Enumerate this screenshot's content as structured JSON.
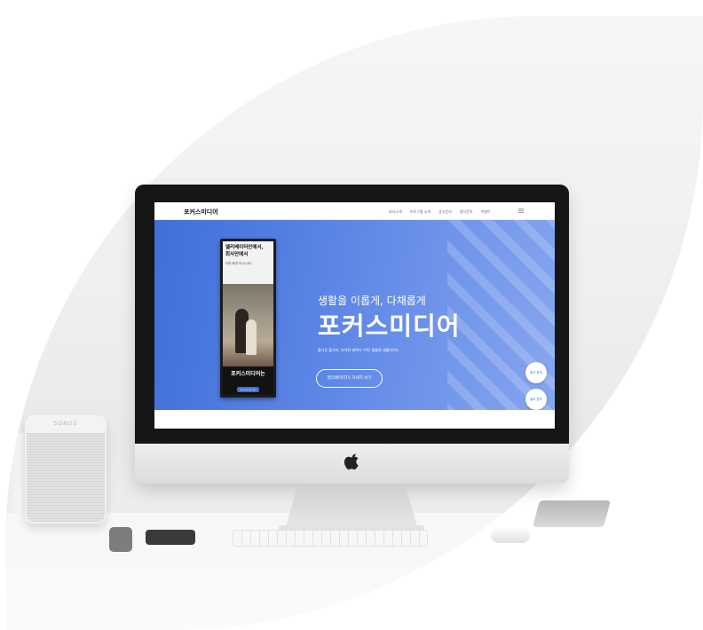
{
  "backdrop": {
    "speaker_label": "SONOS"
  },
  "website": {
    "logo": "포커스미디어",
    "nav_items": [
      "회사소개",
      "프로그램 소개",
      "광고문의",
      "설치문의",
      "이벤트"
    ],
    "hero": {
      "subtitle": "생활을 이롭게, 다채롭게",
      "title": "포커스미디어",
      "description": "즐거운 볼거리, 유익한 혜택이 가득! 쏠쏠한 생활가이드",
      "cta_label": "엘리베이터TV 자세히 보기"
    },
    "side_buttons": [
      "광고 문의",
      "설치 문의"
    ],
    "elevator_tv": {
      "line1": "엘리베이터안에서,",
      "line2": "회사안에서",
      "line3": "어떤 화면 보시나요?",
      "brand": "포커스미디어는",
      "pill": "포커스미디어 광고"
    }
  },
  "colors": {
    "hero_start": "#3f6fd8",
    "hero_end": "#86a6ee"
  }
}
